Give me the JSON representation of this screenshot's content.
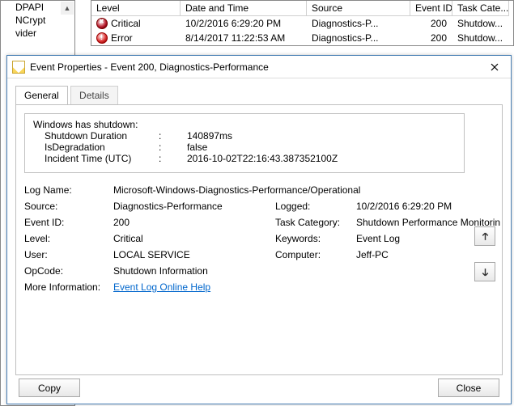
{
  "tree": {
    "items": [
      "DPAPI",
      "NCrypt",
      "vider"
    ]
  },
  "list": {
    "columns": [
      "Level",
      "Date and Time",
      "Source",
      "Event ID",
      "Task Cate..."
    ],
    "rows": [
      {
        "icon": "critical",
        "level": "Critical",
        "datetime": "10/2/2016 6:29:20 PM",
        "source": "Diagnostics-P...",
        "eventid": "200",
        "taskcat": "Shutdow..."
      },
      {
        "icon": "error",
        "level": "Error",
        "datetime": "8/14/2017 11:22:53 AM",
        "source": "Diagnostics-P...",
        "eventid": "200",
        "taskcat": "Shutdow..."
      }
    ]
  },
  "dialog": {
    "title": "Event Properties - Event 200, Diagnostics-Performance",
    "tabs": {
      "general": "General",
      "details": "Details"
    },
    "desc": {
      "heading": "Windows has shutdown:",
      "rows": [
        {
          "k": "Shutdown Duration",
          "v": "140897ms"
        },
        {
          "k": "IsDegradation",
          "v": "false"
        },
        {
          "k": "Incident Time (UTC)",
          "v": "2016-10-02T22:16:43.387352100Z"
        }
      ]
    },
    "fields": {
      "logname_l": "Log Name:",
      "logname_v": "Microsoft-Windows-Diagnostics-Performance/Operational",
      "source_l": "Source:",
      "source_v": "Diagnostics-Performance",
      "logged_l": "Logged:",
      "logged_v": "10/2/2016 6:29:20 PM",
      "eventid_l": "Event ID:",
      "eventid_v": "200",
      "taskcat_l": "Task Category:",
      "taskcat_v": "Shutdown Performance Monitorin",
      "level_l": "Level:",
      "level_v": "Critical",
      "keywords_l": "Keywords:",
      "keywords_v": "Event Log",
      "user_l": "User:",
      "user_v": "LOCAL SERVICE",
      "computer_l": "Computer:",
      "computer_v": "Jeff-PC",
      "opcode_l": "OpCode:",
      "opcode_v": "Shutdown Information",
      "moreinfo_l": "More Information:",
      "moreinfo_v": "Event Log Online Help"
    },
    "buttons": {
      "copy": "Copy",
      "close": "Close"
    }
  }
}
